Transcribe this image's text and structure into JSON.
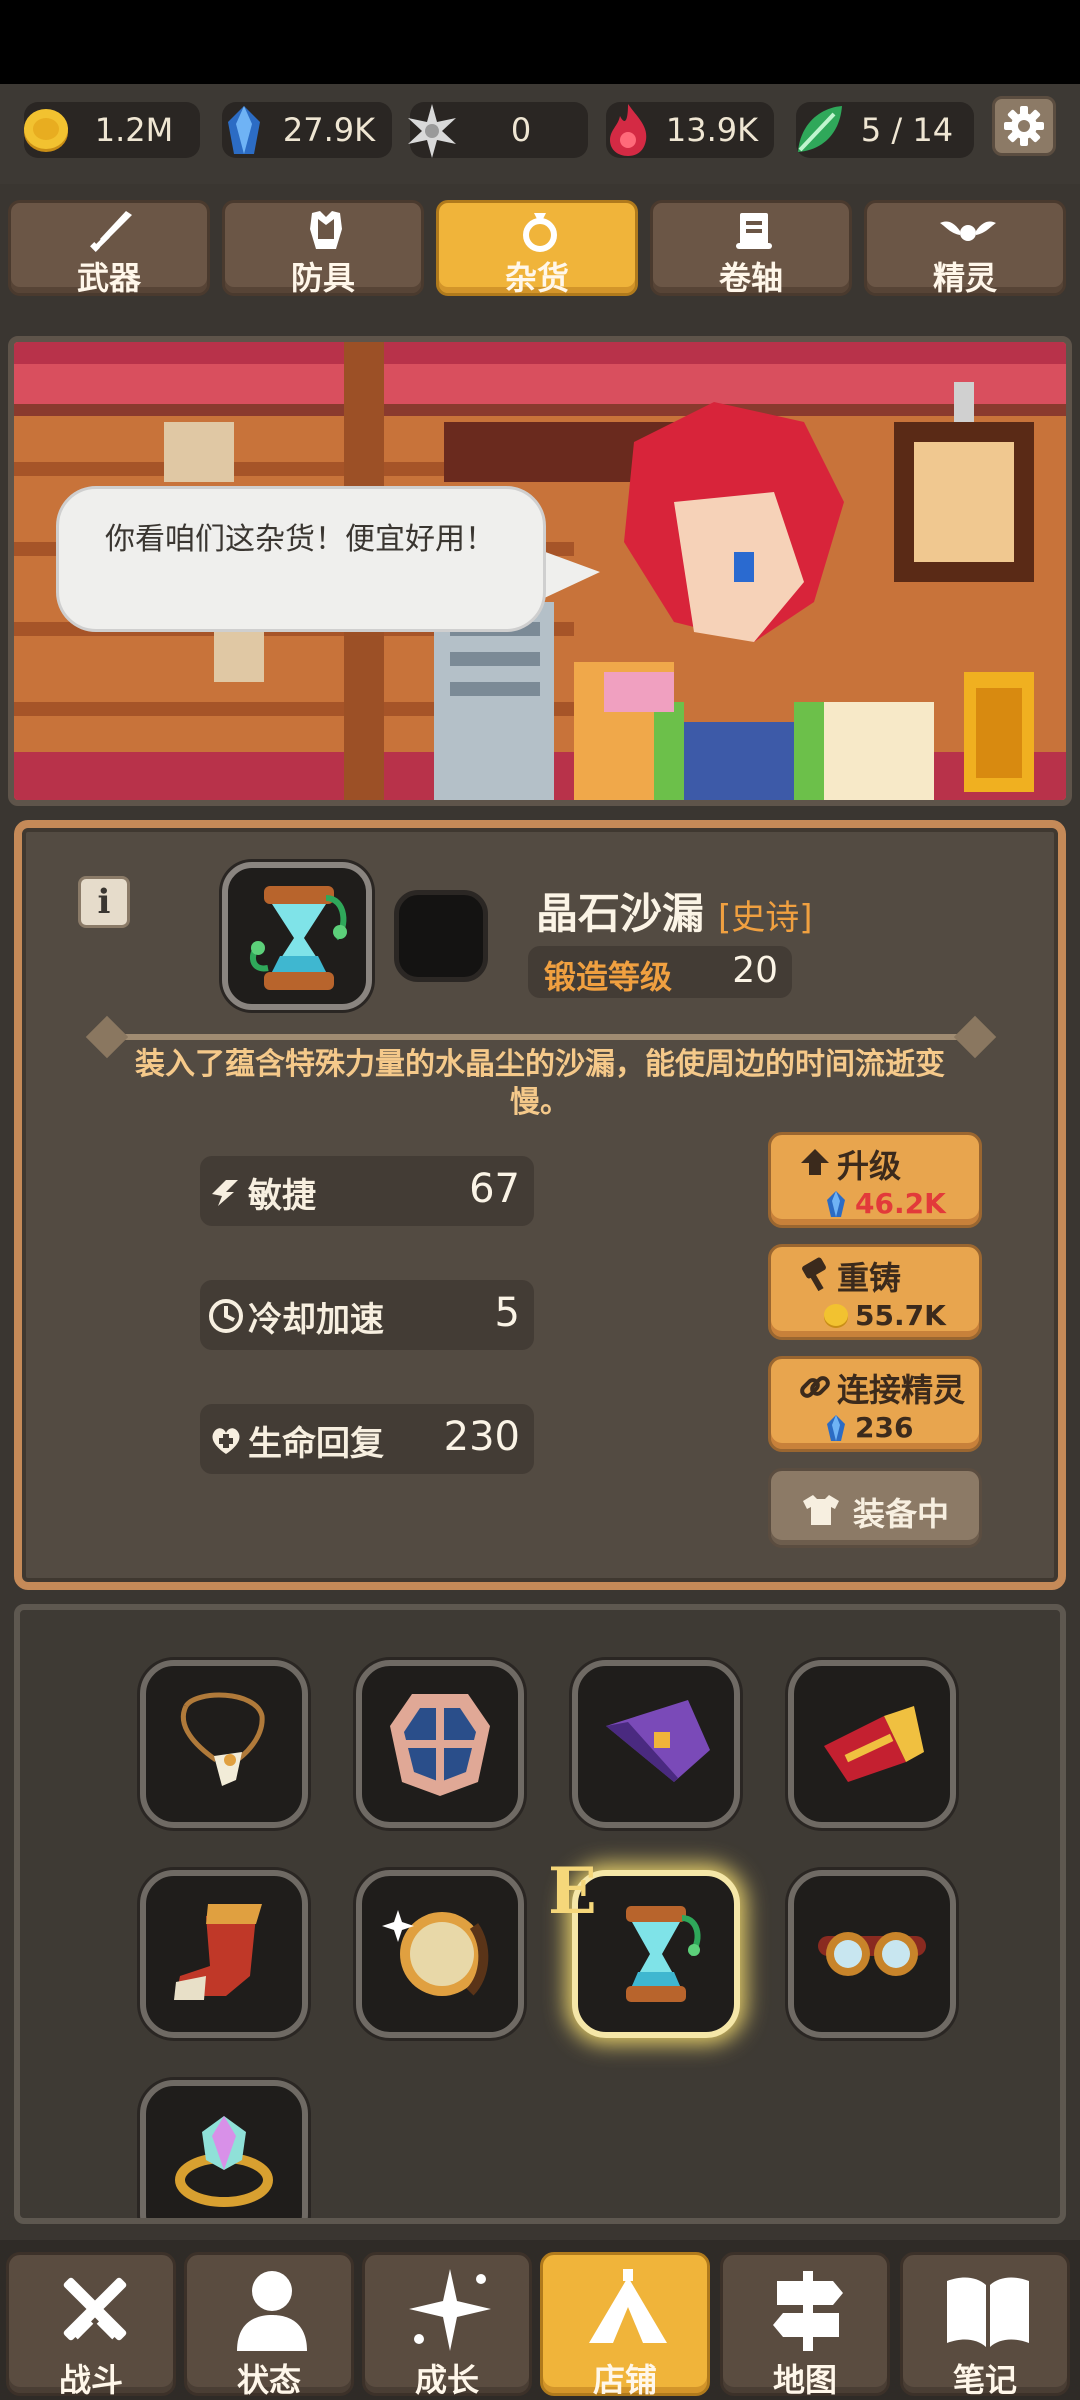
{
  "currencies": [
    {
      "name": "gold",
      "value": "1.2M",
      "icon": "gold-coin-icon",
      "color": "#f2c230"
    },
    {
      "name": "crystal",
      "value": "27.9K",
      "icon": "blue-crystal-icon",
      "color": "#4a90e2"
    },
    {
      "name": "star",
      "value": "0",
      "icon": "silver-star-icon",
      "color": "#cccccc"
    },
    {
      "name": "flame",
      "value": "13.9K",
      "icon": "red-flame-icon",
      "color": "#e0344a"
    },
    {
      "name": "leaf",
      "value": "5 / 14",
      "icon": "green-leaf-icon",
      "color": "#3fbf6a"
    }
  ],
  "category_tabs": [
    {
      "label": "武器",
      "icon": "sword-icon",
      "active": false
    },
    {
      "label": "防具",
      "icon": "armor-icon",
      "active": false
    },
    {
      "label": "杂货",
      "icon": "ring-icon",
      "active": true
    },
    {
      "label": "卷轴",
      "icon": "scroll-icon",
      "active": false
    },
    {
      "label": "精灵",
      "icon": "spirit-wings-icon",
      "active": false
    }
  ],
  "shopkeeper": {
    "dialog": "你看咱们这杂货！便宜好用！"
  },
  "item": {
    "name": "晶石沙漏",
    "rarity": "[史诗]",
    "forge_label": "锻造等级",
    "forge_level": "20",
    "description": "装入了蕴含特殊力量的水晶尘的沙漏，能使周边的时间流逝变慢。",
    "stats": [
      {
        "label": "敏捷",
        "value": "67",
        "icon": "agility-icon"
      },
      {
        "label": "冷却加速",
        "value": "5",
        "icon": "cooldown-icon"
      },
      {
        "label": "生命回复",
        "value": "230",
        "icon": "heal-icon"
      }
    ]
  },
  "actions": {
    "upgrade": {
      "label": "升级",
      "cost": "46.2K",
      "cost_icon": "blue-crystal-icon"
    },
    "reforge": {
      "label": "重铸",
      "cost": "55.7K",
      "cost_icon": "gold-coin-icon"
    },
    "link_spirit": {
      "label": "连接精灵",
      "cost": "236",
      "cost_icon": "blue-crystal-icon"
    },
    "equipped": {
      "label": "装备中"
    }
  },
  "inventory": {
    "equipped_marker": "E",
    "items": [
      {
        "icon": "fang-necklace-icon"
      },
      {
        "icon": "shield-emblem-icon"
      },
      {
        "icon": "wizard-hat-icon"
      },
      {
        "icon": "red-bracer-icon"
      },
      {
        "icon": "spiked-boot-icon"
      },
      {
        "icon": "mirror-icon"
      },
      {
        "icon": "crystal-hourglass-icon",
        "selected": true,
        "equipped": true
      },
      {
        "icon": "goggles-icon"
      },
      {
        "icon": "gem-ring-icon"
      }
    ]
  },
  "bottom_nav": [
    {
      "label": "战斗",
      "icon": "crossed-swords-icon",
      "active": false
    },
    {
      "label": "状态",
      "icon": "person-icon",
      "active": false
    },
    {
      "label": "成长",
      "icon": "sparkle-icon",
      "active": false
    },
    {
      "label": "店铺",
      "icon": "tent-icon",
      "active": true
    },
    {
      "label": "地图",
      "icon": "signpost-icon",
      "active": false
    },
    {
      "label": "笔记",
      "icon": "book-icon",
      "active": false
    }
  ]
}
